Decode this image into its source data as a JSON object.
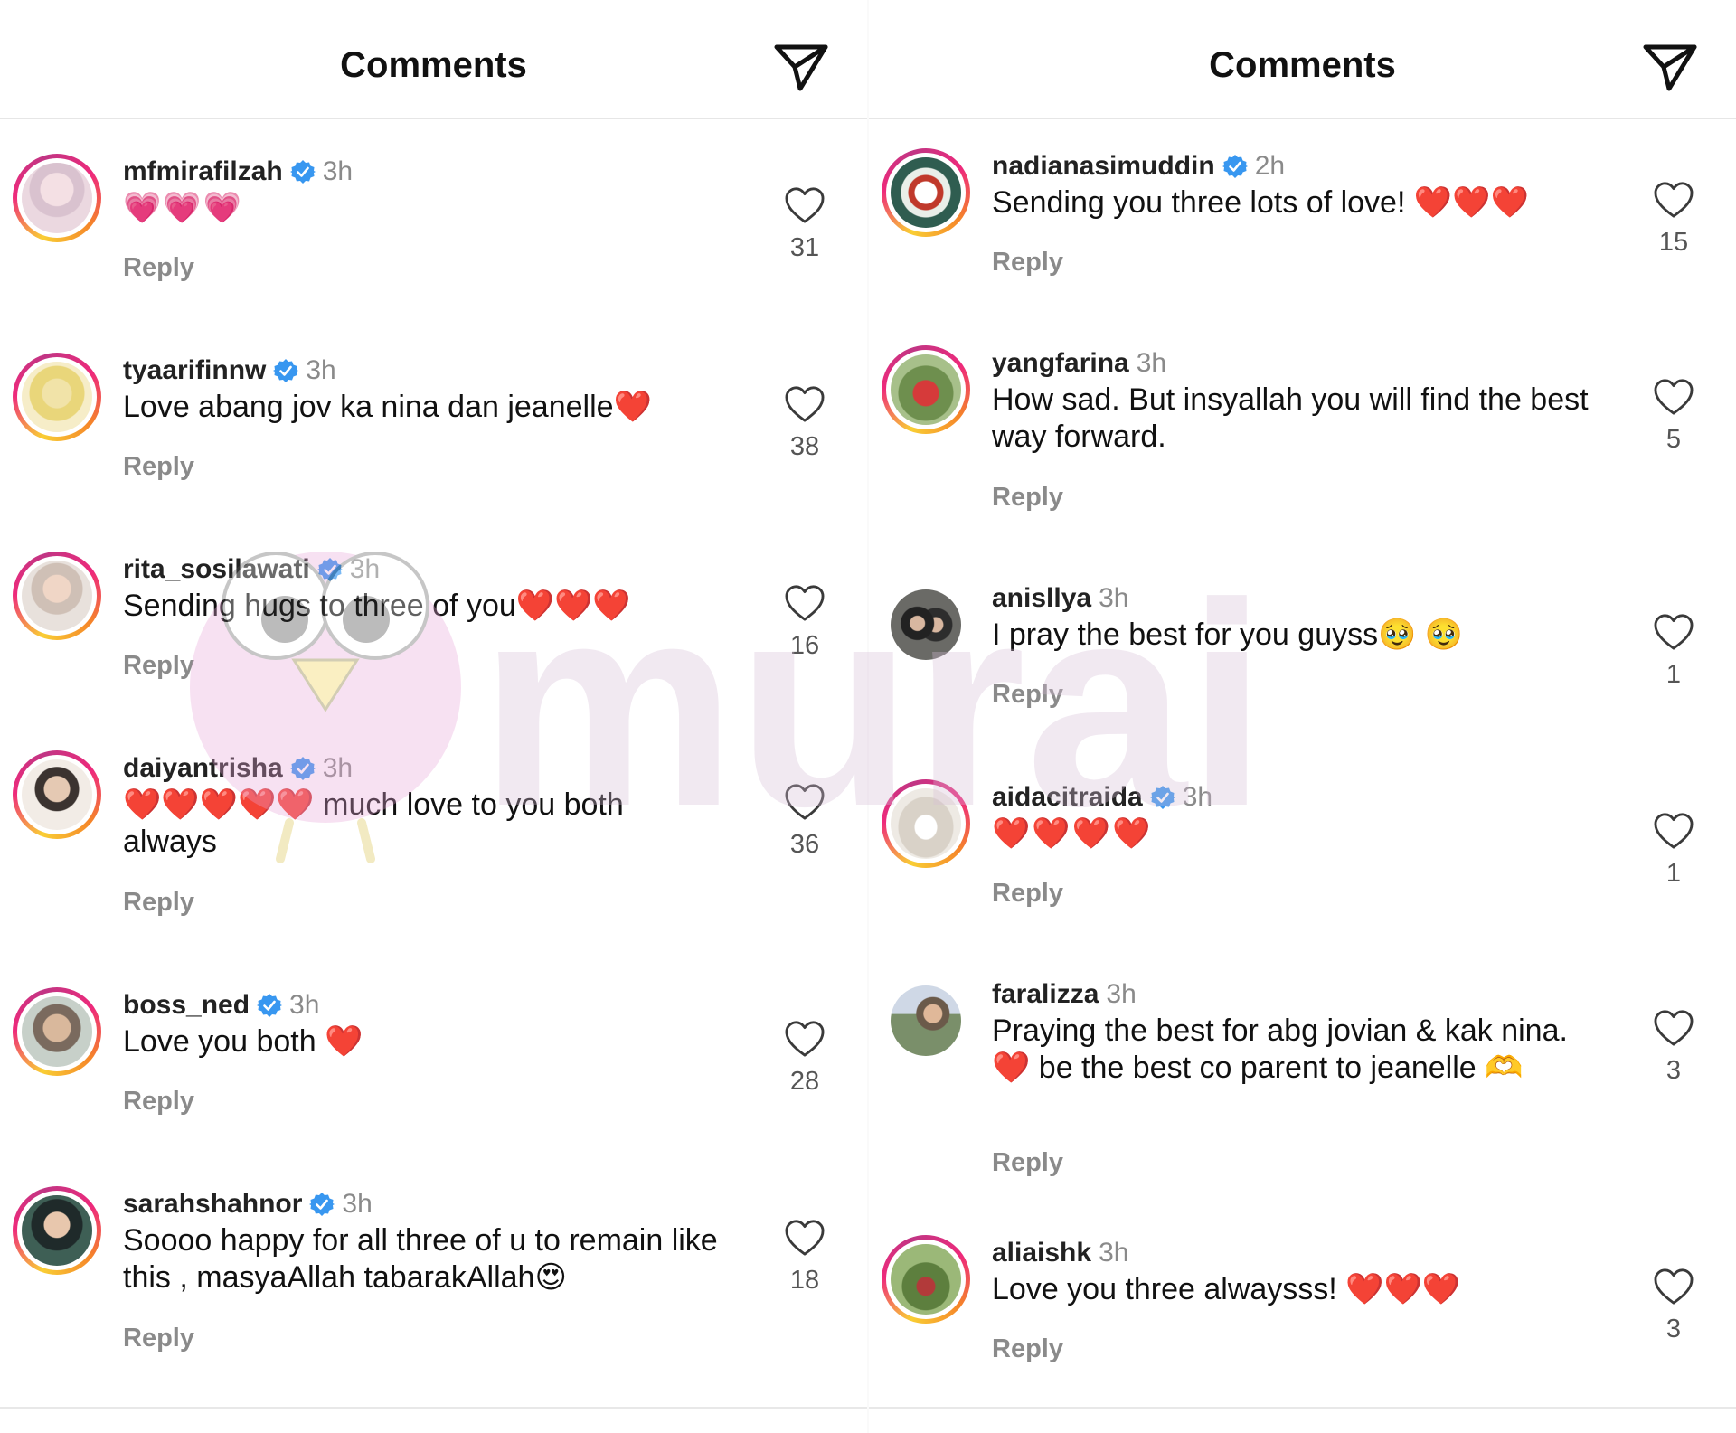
{
  "left": {
    "title": "Comments",
    "comments": [
      {
        "username": "mfmirafilzah",
        "verified": true,
        "time": "3h",
        "text": "💗💗💗",
        "reply": "Reply",
        "likes": "31"
      },
      {
        "username": "tyaarifinnw",
        "verified": true,
        "time": "3h",
        "text": "Love abang jov ka nina dan jeanelle❤️",
        "reply": "Reply",
        "likes": "38"
      },
      {
        "username": "rita_sosilawati",
        "verified": true,
        "time": "3h",
        "text": "Sending hugs to three of you❤️❤️❤️",
        "reply": "Reply",
        "likes": "16"
      },
      {
        "username": "daiyantrisha",
        "verified": true,
        "time": "3h",
        "text": "❤️❤️❤️❤️❤️ much love to you both always",
        "reply": "Reply",
        "likes": "36"
      },
      {
        "username": "boss_ned",
        "verified": true,
        "time": "3h",
        "text": "Love you both ❤️",
        "reply": "Reply",
        "likes": "28"
      },
      {
        "username": "sarahshahnor",
        "verified": true,
        "time": "3h",
        "text": "Soooo happy for all three of u to remain like this , masyaAllah tabarakAllah😍",
        "reply": "Reply",
        "likes": "18"
      }
    ]
  },
  "right": {
    "title": "Comments",
    "comments": [
      {
        "username": "nadianasimuddin",
        "verified": true,
        "time": "2h",
        "text": "Sending you three lots of love! ❤️❤️❤️",
        "reply": "Reply",
        "likes": "15"
      },
      {
        "username": "yangfarina",
        "verified": false,
        "time": "3h",
        "text": "How sad. But insyallah you will find the best way forward.",
        "reply": "Reply",
        "likes": "5"
      },
      {
        "username": "anisllya",
        "verified": false,
        "time": "3h",
        "text": "I pray the best for you guyss🥹 🥹",
        "reply": "Reply",
        "likes": "1"
      },
      {
        "username": "aidacitraida",
        "verified": true,
        "time": "3h",
        "text": "❤️❤️❤️❤️",
        "reply": "Reply",
        "likes": "1"
      },
      {
        "username": "faralizza",
        "verified": false,
        "time": "3h",
        "text": "Praying the best for abg jovian & kak nina.❤️ be the best co parent to jeanelle 🫶",
        "reply": "Reply",
        "likes": "3"
      },
      {
        "username": "aliaishk",
        "verified": false,
        "time": "3h",
        "text": "Love you three alwaysss! ❤️❤️❤️",
        "reply": "Reply",
        "likes": "3"
      }
    ]
  },
  "watermark": {
    "text": "murai"
  },
  "icons": {
    "send": "paper-plane-icon",
    "like": "heart-outline-icon",
    "verified": "verified-badge-icon"
  },
  "colors": {
    "verified": "#3897f0",
    "muted": "#8a8a8a",
    "divider": "#e6e6e6"
  }
}
